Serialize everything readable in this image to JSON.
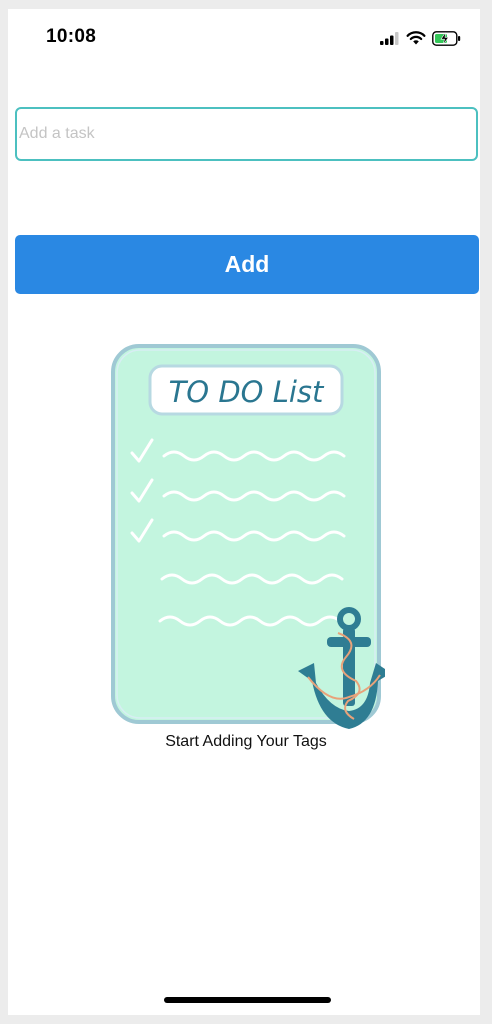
{
  "status_bar": {
    "time": "10:08",
    "icons": [
      "cellular-signal-icon",
      "wifi-icon",
      "battery-charging-icon"
    ]
  },
  "task_input": {
    "placeholder": "Add a task",
    "value": ""
  },
  "add_button": {
    "label": "Add"
  },
  "illustration": {
    "title": "TO DO List",
    "checked_rows": 3,
    "total_rows": 5
  },
  "caption": "Start Adding Your Tags",
  "colors": {
    "accent": "#2a88e3",
    "input_border": "#4cc0c0",
    "card_fill": "#c3f5df",
    "anchor": "#2f7d93"
  }
}
